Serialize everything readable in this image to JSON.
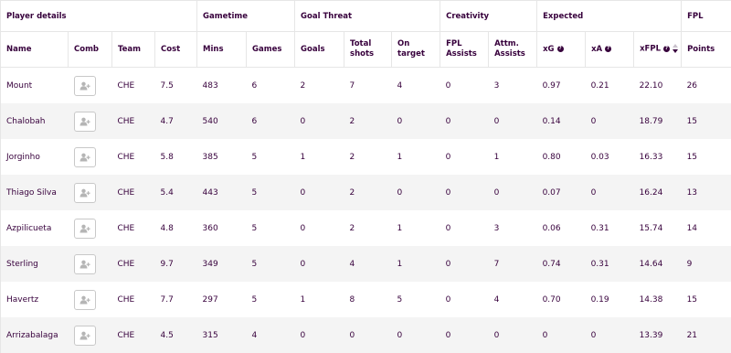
{
  "groups": {
    "player_details": "Player details",
    "gametime": "Gametime",
    "goal_threat": "Goal Threat",
    "creativity": "Creativity",
    "expected": "Expected",
    "fpl": "FPL"
  },
  "columns": {
    "name": "Name",
    "comb": "Comb",
    "team": "Team",
    "cost": "Cost",
    "mins": "Mins",
    "games": "Games",
    "goals": "Goals",
    "total_shots_1": "Total",
    "total_shots_2": "shots",
    "on_target_1": "On",
    "on_target_2": "target",
    "fpl_assists_1": "FPL",
    "fpl_assists_2": "Assists",
    "attm_assists_1": "Attm.",
    "attm_assists_2": "Assists",
    "xg": "xG",
    "xa": "xA",
    "xfpl": "xFPL",
    "points": "Points"
  },
  "icons": {
    "info": "question-circle-icon",
    "sort": "sort-descending-icon",
    "comb": "add-user-icon"
  },
  "colors": {
    "text": "#37003c",
    "row_alt": "#f4f4f4",
    "border": "#e6e6e6"
  },
  "rows": [
    {
      "name": "Mount",
      "team": "CHE",
      "cost": "7.5",
      "mins": "483",
      "games": "6",
      "goals": "2",
      "shots": "7",
      "on_target": "4",
      "fpl_assists": "0",
      "attm_assists": "3",
      "xg": "0.97",
      "xa": "0.21",
      "xfpl": "22.10",
      "points": "26"
    },
    {
      "name": "Chalobah",
      "team": "CHE",
      "cost": "4.7",
      "mins": "540",
      "games": "6",
      "goals": "0",
      "shots": "2",
      "on_target": "0",
      "fpl_assists": "0",
      "attm_assists": "0",
      "xg": "0.14",
      "xa": "0",
      "xfpl": "18.79",
      "points": "15"
    },
    {
      "name": "Jorginho",
      "team": "CHE",
      "cost": "5.8",
      "mins": "385",
      "games": "5",
      "goals": "1",
      "shots": "2",
      "on_target": "1",
      "fpl_assists": "0",
      "attm_assists": "1",
      "xg": "0.80",
      "xa": "0.03",
      "xfpl": "16.33",
      "points": "15"
    },
    {
      "name": "Thiago Silva",
      "team": "CHE",
      "cost": "5.4",
      "mins": "443",
      "games": "5",
      "goals": "0",
      "shots": "2",
      "on_target": "0",
      "fpl_assists": "0",
      "attm_assists": "0",
      "xg": "0.07",
      "xa": "0",
      "xfpl": "16.24",
      "points": "13"
    },
    {
      "name": "Azpilicueta",
      "team": "CHE",
      "cost": "4.8",
      "mins": "360",
      "games": "5",
      "goals": "0",
      "shots": "2",
      "on_target": "1",
      "fpl_assists": "0",
      "attm_assists": "3",
      "xg": "0.06",
      "xa": "0.31",
      "xfpl": "15.74",
      "points": "14"
    },
    {
      "name": "Sterling",
      "team": "CHE",
      "cost": "9.7",
      "mins": "349",
      "games": "5",
      "goals": "0",
      "shots": "4",
      "on_target": "1",
      "fpl_assists": "0",
      "attm_assists": "7",
      "xg": "0.74",
      "xa": "0.31",
      "xfpl": "14.64",
      "points": "9"
    },
    {
      "name": "Havertz",
      "team": "CHE",
      "cost": "7.7",
      "mins": "297",
      "games": "5",
      "goals": "1",
      "shots": "8",
      "on_target": "5",
      "fpl_assists": "0",
      "attm_assists": "4",
      "xg": "0.70",
      "xa": "0.19",
      "xfpl": "14.38",
      "points": "15"
    },
    {
      "name": "Arrizabalaga",
      "team": "CHE",
      "cost": "4.5",
      "mins": "315",
      "games": "4",
      "goals": "0",
      "shots": "0",
      "on_target": "0",
      "fpl_assists": "0",
      "attm_assists": "0",
      "xg": "0",
      "xa": "0",
      "xfpl": "13.39",
      "points": "21"
    }
  ]
}
